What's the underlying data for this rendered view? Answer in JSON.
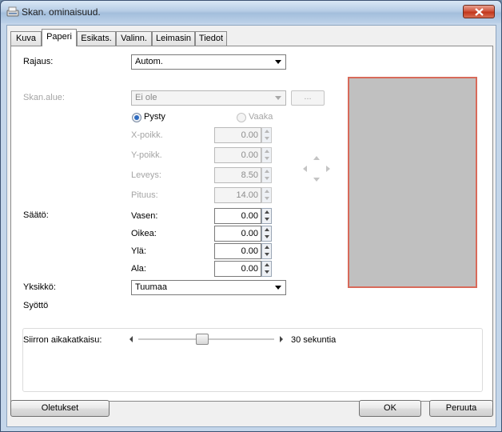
{
  "window": {
    "title": "Skan. ominaisuud."
  },
  "tabs": [
    "Kuva",
    "Paperi",
    "Esikats.",
    "Valinn.",
    "Leimasin",
    "Tiedot"
  ],
  "active_tab": "Paperi",
  "cropping": {
    "label": "Rajaus:",
    "value": "Autom."
  },
  "scan_area": {
    "label": "Skan.alue:",
    "value": "Ei ole",
    "more_button": "..."
  },
  "orientation": {
    "portrait": "Pysty",
    "landscape": "Vaaka",
    "selected": "Pysty"
  },
  "fields": {
    "x_offset": {
      "label": "X-poikk.",
      "value": "0.00"
    },
    "y_offset": {
      "label": "Y-poikk.",
      "value": "0.00"
    },
    "width": {
      "label": "Leveys:",
      "value": "8.50"
    },
    "length": {
      "label": "Pituus:",
      "value": "14.00"
    }
  },
  "adjust": {
    "label": "Säätö:",
    "left": {
      "label": "Vasen:",
      "value": "0.00"
    },
    "right": {
      "label": "Oikea:",
      "value": "0.00"
    },
    "top": {
      "label": "Ylä:",
      "value": "0.00"
    },
    "bottom": {
      "label": "Ala:",
      "value": "0.00"
    }
  },
  "unit": {
    "label": "Yksikkö:",
    "value": "Tuumaa"
  },
  "feed": {
    "group_label": "Syöttö",
    "timeout_label": "Siirron aikakatkaisu:",
    "timeout_value": "30 sekuntia"
  },
  "buttons": {
    "defaults": "Oletukset",
    "ok": "OK",
    "cancel": "Peruuta"
  }
}
